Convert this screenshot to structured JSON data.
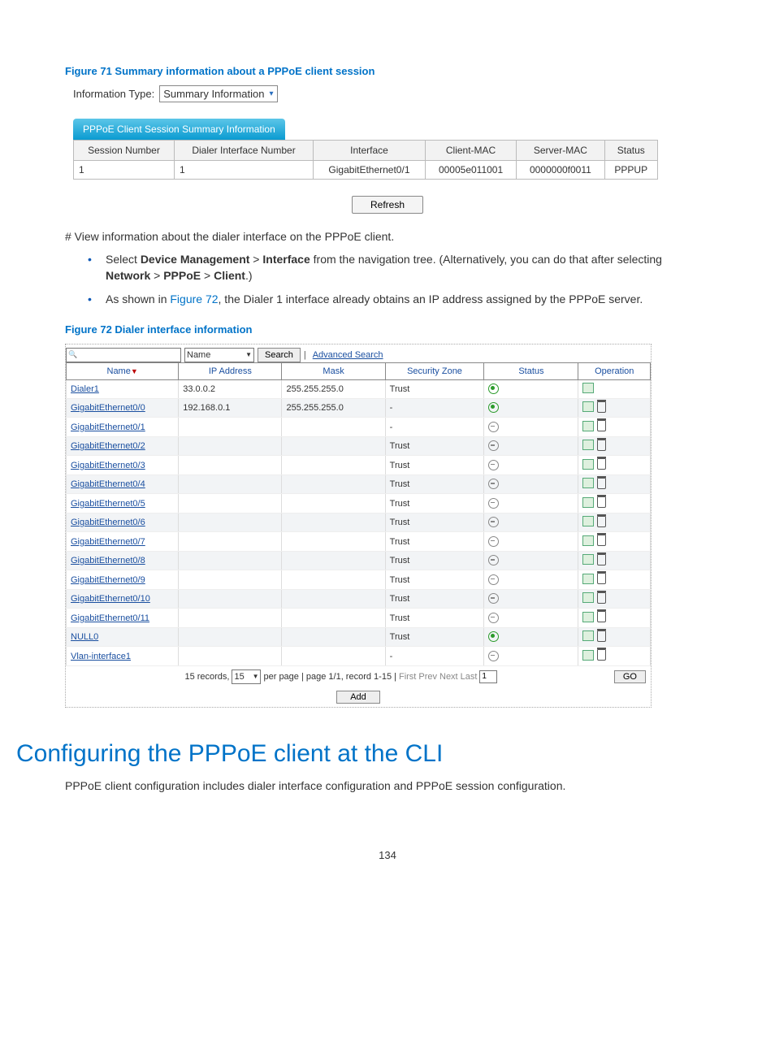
{
  "figure71_caption": "Figure 71 Summary information about a PPPoE client session",
  "info_type_label": "Information Type:",
  "info_type_value": "Summary Information",
  "tab_title": "PPPoE Client Session Summary Information",
  "session_headers": {
    "session_num": "Session Number",
    "dialer_if": "Dialer Interface Number",
    "iface": "Interface",
    "client_mac": "Client-MAC",
    "server_mac": "Server-MAC",
    "status": "Status"
  },
  "session_row": {
    "session_num": "1",
    "dialer_if": "1",
    "iface": "GigabitEthernet0/1",
    "client_mac": "00005e011001",
    "server_mac": "0000000f0011",
    "status": "PPPUP"
  },
  "refresh_label": "Refresh",
  "para_view": "# View information about the dialer interface on the PPPoE client.",
  "bullet1_pre": "Select ",
  "bullet1_b1": "Device Management",
  "bullet1_gt1": " > ",
  "bullet1_b2": "Interface",
  "bullet1_mid": " from the navigation tree. (Alternatively, you can do that after selecting ",
  "bullet1_b3": "Network",
  "bullet1_gt2": " > ",
  "bullet1_b4": "PPPoE",
  "bullet1_gt3": " > ",
  "bullet1_b5": "Client",
  "bullet1_end": ".)",
  "bullet2_pre": "As shown in ",
  "bullet2_link": "Figure 72",
  "bullet2_post": ", the Dialer 1 interface already obtains an IP address assigned by the PPPoE server.",
  "figure72_caption": "Figure 72 Dialer interface information",
  "search": {
    "field": "Name",
    "search_btn": "Search",
    "adv": "Advanced Search"
  },
  "iface_headers": {
    "name": "Name",
    "ip": "IP Address",
    "mask": "Mask",
    "zone": "Security Zone",
    "status": "Status",
    "op": "Operation"
  },
  "iface_rows": [
    {
      "name": "Dialer1",
      "ip": "33.0.0.2",
      "mask": "255.255.255.0",
      "zone": "Trust",
      "status": "green",
      "ops": "edit"
    },
    {
      "name": "GigabitEthernet0/0",
      "ip": "192.168.0.1",
      "mask": "255.255.255.0",
      "zone": "-",
      "status": "green",
      "ops": "both"
    },
    {
      "name": "GigabitEthernet0/1",
      "ip": "",
      "mask": "",
      "zone": "-",
      "status": "grey",
      "ops": "both"
    },
    {
      "name": "GigabitEthernet0/2",
      "ip": "",
      "mask": "",
      "zone": "Trust",
      "status": "grey",
      "ops": "both"
    },
    {
      "name": "GigabitEthernet0/3",
      "ip": "",
      "mask": "",
      "zone": "Trust",
      "status": "grey",
      "ops": "both"
    },
    {
      "name": "GigabitEthernet0/4",
      "ip": "",
      "mask": "",
      "zone": "Trust",
      "status": "grey",
      "ops": "both"
    },
    {
      "name": "GigabitEthernet0/5",
      "ip": "",
      "mask": "",
      "zone": "Trust",
      "status": "grey",
      "ops": "both"
    },
    {
      "name": "GigabitEthernet0/6",
      "ip": "",
      "mask": "",
      "zone": "Trust",
      "status": "grey",
      "ops": "both"
    },
    {
      "name": "GigabitEthernet0/7",
      "ip": "",
      "mask": "",
      "zone": "Trust",
      "status": "grey",
      "ops": "both"
    },
    {
      "name": "GigabitEthernet0/8",
      "ip": "",
      "mask": "",
      "zone": "Trust",
      "status": "grey",
      "ops": "both"
    },
    {
      "name": "GigabitEthernet0/9",
      "ip": "",
      "mask": "",
      "zone": "Trust",
      "status": "grey",
      "ops": "both"
    },
    {
      "name": "GigabitEthernet0/10",
      "ip": "",
      "mask": "",
      "zone": "Trust",
      "status": "grey",
      "ops": "both"
    },
    {
      "name": "GigabitEthernet0/11",
      "ip": "",
      "mask": "",
      "zone": "Trust",
      "status": "grey",
      "ops": "both"
    },
    {
      "name": "NULL0",
      "ip": "",
      "mask": "",
      "zone": "Trust",
      "status": "green",
      "ops": "both"
    },
    {
      "name": "Vlan-interface1",
      "ip": "",
      "mask": "",
      "zone": "-",
      "status": "grey",
      "ops": "both"
    }
  ],
  "pager": {
    "records": "15 records,",
    "per_page_val": "15",
    "per_page": "per page | page 1/1, record 1-15 |",
    "first": "First",
    "prev": "Prev",
    "next": "Next",
    "last": "Last",
    "goto": "1",
    "go": "GO"
  },
  "add_label": "Add",
  "h1": "Configuring the PPPoE client at the CLI",
  "intro": "PPPoE client configuration includes dialer interface configuration and PPPoE session configuration.",
  "page_num": "134"
}
